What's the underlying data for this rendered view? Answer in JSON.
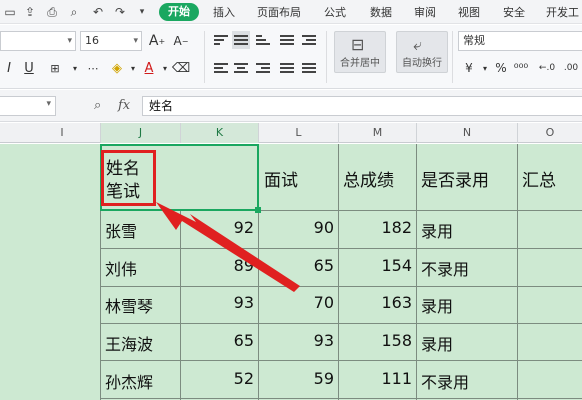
{
  "menu": {
    "start": "开始",
    "items": [
      "插入",
      "页面布局",
      "公式",
      "数据",
      "审阅",
      "视图",
      "安全",
      "开发工"
    ]
  },
  "ribbon": {
    "font_name": "",
    "font_size": "16",
    "number_format": "常规",
    "merge_center": "合并居中",
    "wrap_text": "自动换行",
    "percent_symbol": "%",
    "decimal_inc": "+0\n.00",
    "decimal_dec": ".00\n→.0"
  },
  "formula_bar": {
    "name_box": "",
    "fx_label": "fx",
    "content": "姓名"
  },
  "columns": [
    "I",
    "J",
    "K",
    "L",
    "M",
    "N",
    "O"
  ],
  "header_row": {
    "j_line1": "姓名",
    "j_line2": "笔试",
    "l": "面试",
    "m": "总成绩",
    "n": "是否录用",
    "o": "汇总"
  },
  "rows": [
    {
      "name": "张雪",
      "written": "92",
      "interview": "90",
      "total": "182",
      "hired": "录用"
    },
    {
      "name": "刘伟",
      "written": "89",
      "interview": "65",
      "total": "154",
      "hired": "不录用"
    },
    {
      "name": "林雪琴",
      "written": "93",
      "interview": "70",
      "total": "163",
      "hired": "录用"
    },
    {
      "name": "王海波",
      "written": "65",
      "interview": "93",
      "total": "158",
      "hired": "录用"
    },
    {
      "name": "孙杰辉",
      "written": "52",
      "interview": "59",
      "total": "111",
      "hired": "不录用"
    }
  ],
  "colors": {
    "sheet_bg": "#cde9d2",
    "accent_green": "#1aa760",
    "highlight_red": "#e02020"
  }
}
